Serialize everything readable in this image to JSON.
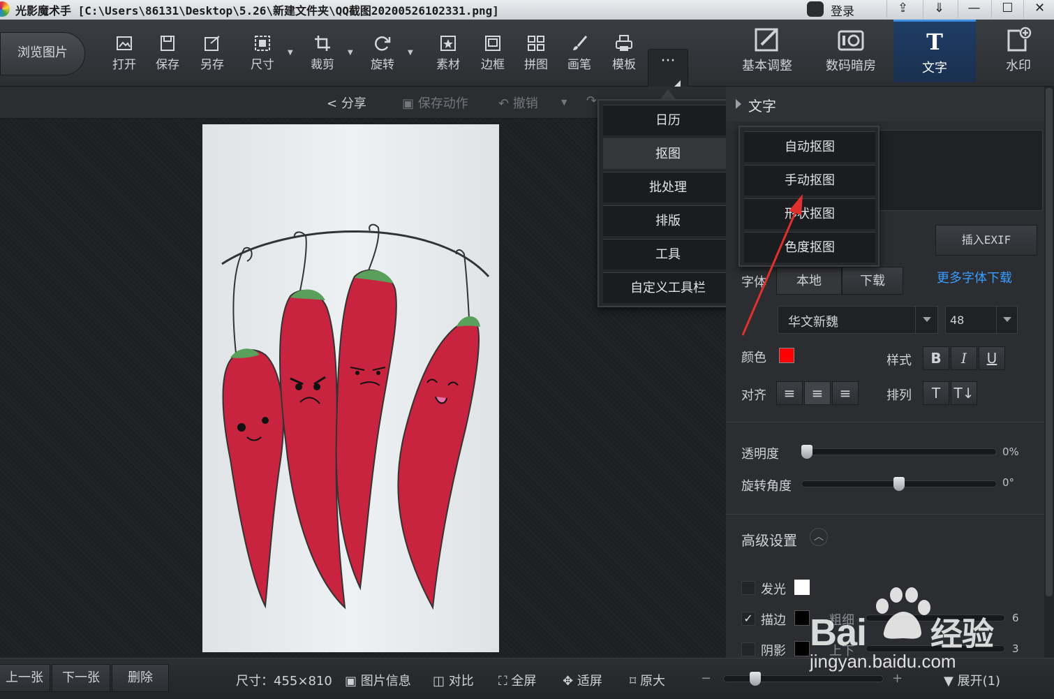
{
  "window": {
    "title": "光影魔术手  [C:\\Users\\86131\\Desktop\\5.26\\新建文件夹\\QQ截图20200526102331.png]",
    "login_label": "登录",
    "controls": [
      "⇪",
      "⇓",
      "—",
      "☐",
      "✕"
    ]
  },
  "toolbar": {
    "browse_label": "浏览图片",
    "tools": [
      {
        "label": "打开",
        "icon": "open-icon"
      },
      {
        "label": "保存",
        "icon": "save-icon"
      },
      {
        "label": "另存",
        "icon": "save-as-icon"
      },
      {
        "label": "尺寸",
        "icon": "resize-icon"
      },
      {
        "label": "裁剪",
        "icon": "crop-icon"
      },
      {
        "label": "旋转",
        "icon": "rotate-icon"
      },
      {
        "label": "素材",
        "icon": "material-icon"
      },
      {
        "label": "边框",
        "icon": "border-icon"
      },
      {
        "label": "拼图",
        "icon": "collage-icon"
      },
      {
        "label": "画笔",
        "icon": "brush-icon"
      },
      {
        "label": "模板",
        "icon": "template-icon"
      }
    ],
    "more_label": "···"
  },
  "right_tabs": [
    {
      "label": "基本调整",
      "icon": "adjust-icon"
    },
    {
      "label": "数码暗房",
      "icon": "darkroom-icon"
    },
    {
      "label": "文字",
      "icon": "text-icon",
      "active": true
    },
    {
      "label": "水印",
      "icon": "watermark-icon"
    }
  ],
  "subbar": {
    "share": "分享",
    "save_action": "保存动作",
    "undo": "撤销"
  },
  "more_menu": {
    "items": [
      "日历",
      "抠图",
      "批处理",
      "排版",
      "工具",
      "自定义工具栏"
    ],
    "highlighted": "抠图"
  },
  "matting_menu": {
    "items": [
      "自动抠图",
      "手动抠图",
      "形状抠图",
      "色度抠图"
    ]
  },
  "text_panel": {
    "title": "文字",
    "insert_exif": "插入EXIF",
    "font_label": "字体",
    "font_local": "本地",
    "font_download": "下载",
    "more_fonts": "更多字体下载",
    "font_name": "华文新魏",
    "font_size": "48",
    "color_label": "颜色",
    "color_value": "#ff0000",
    "style_label": "样式",
    "style_buttons": [
      "B",
      "I",
      "U"
    ],
    "align_label": "对齐",
    "arrange_label": "排列",
    "opacity_label": "透明度",
    "opacity_value": "0%",
    "opacity_level": 0,
    "rotation_label": "旋转角度",
    "rotation_value": "0°",
    "rotation_level": 0.5,
    "advanced_label": "高级设置",
    "glow_label": "发光",
    "stroke_label": "描边",
    "stroke_checked": true,
    "stroke_thickness_label": "粗细",
    "stroke_thickness_value": "6",
    "shadow_label": "阴影",
    "shadow_offset_label": "上下",
    "shadow_value": "3"
  },
  "statusbar": {
    "prev": "上一张",
    "next": "下一张",
    "delete": "删除",
    "size_label": "尺寸：455×810",
    "image_info": "图片信息",
    "compare": "对比",
    "fullscreen": "全屏",
    "fit_screen": "适屏",
    "original_size": "原大",
    "zoom_minus": "−",
    "zoom_plus": "+",
    "expand": "展开(1)"
  },
  "watermark": {
    "brand": "Bai",
    "brand_suffix": "经验",
    "url": "jingyan.baidu.com"
  },
  "colors": {
    "accent": "#3a8ee6",
    "link": "#3b9cff",
    "pepper": "#c8243f"
  }
}
